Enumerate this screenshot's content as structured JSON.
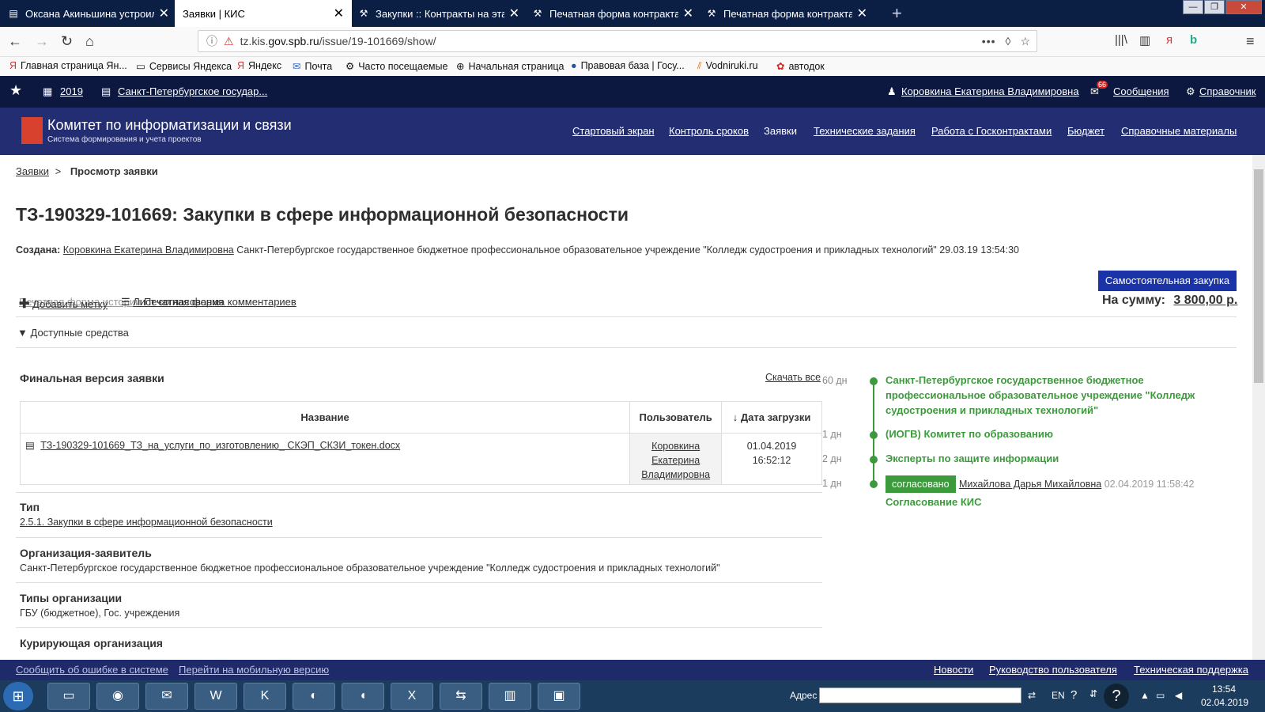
{
  "browser": {
    "tabs": [
      {
        "label": "Оксана Акиньшина устроила",
        "active": false
      },
      {
        "label": "Заявки | КИС",
        "active": true
      },
      {
        "label": "Закупки :: Контракты на этапе",
        "active": false
      },
      {
        "label": "Печатная форма контракта",
        "active": false
      },
      {
        "label": "Печатная форма контракта",
        "active": false
      }
    ],
    "url_prefix": "tz.kis.",
    "url_host": "gov.spb.ru",
    "url_path": "/issue/19-101669/show/",
    "bookmarks": [
      "Главная страница Ян...",
      "Сервисы Яндекса",
      "Яндекс",
      "Почта",
      "Часто посещаемые",
      "Начальная страница",
      "Правовая база | Госу...",
      "Vodniruki.ru",
      "автодок"
    ]
  },
  "topstrip": {
    "year": "2019",
    "org_short": "Санкт-Петербургское государ...",
    "user": "Коровкина Екатерина Владимировна",
    "messages_label": "Сообщения",
    "messages_count": "66",
    "reference_label": "Справочник"
  },
  "header": {
    "title": "Комитет по информатизации и связи",
    "subtitle": "Система формирования и учета проектов",
    "menu": [
      {
        "label": "Стартовый экран",
        "link": true
      },
      {
        "label": "Контроль сроков",
        "link": true
      },
      {
        "label": "Заявки",
        "link": false
      },
      {
        "label": "Технические задания",
        "link": true
      },
      {
        "label": "Работа с Госконтрактами",
        "link": true
      },
      {
        "label": "Бюджет",
        "link": true
      },
      {
        "label": "Справочные материалы",
        "link": true
      }
    ]
  },
  "page": {
    "breadcrumb_root": "Заявки",
    "breadcrumb_sep": ">",
    "breadcrumb_current": "Просмотр заявки",
    "title": "ТЗ-190329-101669: Закупки в сфере информационной безопасности",
    "created_label": "Создана:",
    "created_by": "Коровкина Екатерина Владимировна",
    "created_org": "Санкт-Петербургское государственное бюджетное профессиональное образовательное учреждение \"Колледж судостроения и прикладных технологий\" 29.03.19 13:54:30",
    "self_purchase_button": "Самостоятельная закупка",
    "actions": {
      "add_tag": "Добавить метку",
      "approval_sheet": "Лист согласования",
      "print_history": "Печатная форма истории",
      "print_comments": "Печатная форма комментариев"
    },
    "sum_label": "На сумму:",
    "sum_value": "3 800,00 р.",
    "funds_label": "Доступные средства",
    "final_version_title": "Финальная версия заявки",
    "download_all": "Скачать все",
    "files_table": {
      "headers": {
        "name": "Название",
        "user": "Пользователь",
        "date": "Дата загрузки"
      },
      "rows": [
        {
          "file": "ТЗ-190329-101669_ТЗ_на_услуги_по_изготовлению_ СКЭП_СКЗИ_токен.docx",
          "user_line1": "Коровкина",
          "user_line2": "Екатерина",
          "user_line3": "Владимировна",
          "date": "01.04.2019",
          "time": "16:52:12"
        }
      ]
    },
    "sections": {
      "type_label": "Тип",
      "type_value": "2.5.1. Закупки в сфере информационной безопасности",
      "org_label": "Организация-заявитель",
      "org_value": "Санкт-Петербургское государственное бюджетное профессиональное образовательное учреждение \"Колледж судостроения и прикладных технологий\"",
      "org_types_label": "Типы организации",
      "org_types_value": "ГБУ (бюджетное), Гос. учреждения",
      "curator_label": "Курирующая организация"
    },
    "timeline": [
      {
        "days": "60 дн",
        "text": "Санкт-Петербургское государственное бюджетное профессиональное образовательное учреждение \"Колледж судостроения и прикладных технологий\""
      },
      {
        "days": "1 дн",
        "text": "(ИОГВ) Комитет по образованию"
      },
      {
        "days": "2 дн",
        "text": "Эксперты по защите информации"
      },
      {
        "days": "1 дн",
        "badge": "согласовано",
        "approver": "Михайлова Дарья Михайловна",
        "date": "02.04.2019 11:58:42",
        "text": "Согласование КИС"
      }
    ]
  },
  "footer": {
    "report_error": "Сообщить об ошибке в системе",
    "mobile": "Перейти на мобильную версию",
    "news": "Новости",
    "manual": "Руководство пользователя",
    "support": "Техническая поддержка"
  },
  "taskbar": {
    "address_label": "Адрес",
    "lang": "EN",
    "time": "13:54",
    "date": "02.04.2019"
  },
  "colors": {
    "header_bg": "#222d72",
    "topstrip_bg": "#0c1840",
    "accent_button": "#1a33a8",
    "timeline_green": "#3c9a3c"
  }
}
